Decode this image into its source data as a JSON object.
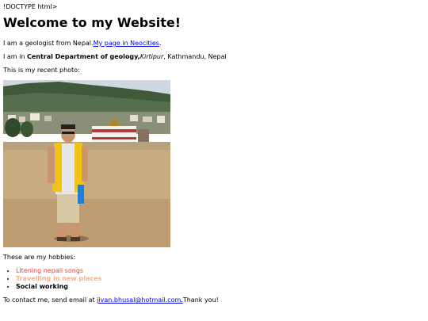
{
  "doctype_text": "!DOCTYPE html>",
  "heading": "Welcome to my Website!",
  "intro": {
    "text": "I am a geologist from Nepal.",
    "link_text": "My page in Neocities",
    "after": "."
  },
  "location": {
    "prefix": "I am in ",
    "department": "Central Department of geology,",
    "campus": "Kirtipur",
    "rest": ", Kathmandu, Nepal"
  },
  "photo_caption": "This is my recent photo:",
  "photo_icon": "photo-of-person-on-ground",
  "hobbies_intro": "These are my hobbies:",
  "hobbies": [
    {
      "label": "Litening nepali songs",
      "color": "#e53935"
    },
    {
      "label": "Travelling in new places",
      "color": "#f4b183"
    },
    {
      "label": "Social working",
      "color": "#000000"
    }
  ],
  "contact": {
    "prefix": "To contact me, send email at ",
    "email": "jivan.bhusal@hotmail.com.",
    "suffix": "Thank you!"
  }
}
